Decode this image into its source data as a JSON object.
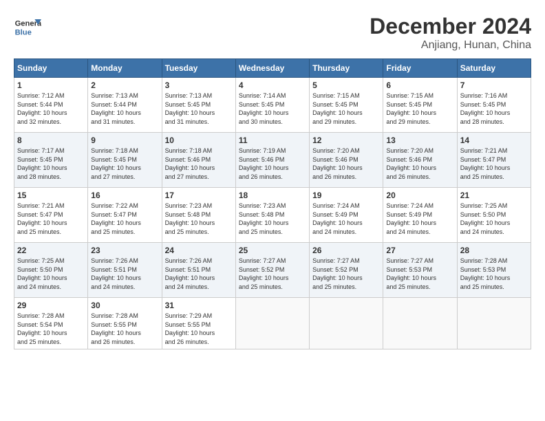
{
  "header": {
    "logo_line1": "General",
    "logo_line2": "Blue",
    "month": "December 2024",
    "location": "Anjiang, Hunan, China"
  },
  "weekdays": [
    "Sunday",
    "Monday",
    "Tuesday",
    "Wednesday",
    "Thursday",
    "Friday",
    "Saturday"
  ],
  "weeks": [
    [
      {
        "day": "1",
        "info": "Sunrise: 7:12 AM\nSunset: 5:44 PM\nDaylight: 10 hours\nand 32 minutes."
      },
      {
        "day": "2",
        "info": "Sunrise: 7:13 AM\nSunset: 5:44 PM\nDaylight: 10 hours\nand 31 minutes."
      },
      {
        "day": "3",
        "info": "Sunrise: 7:13 AM\nSunset: 5:45 PM\nDaylight: 10 hours\nand 31 minutes."
      },
      {
        "day": "4",
        "info": "Sunrise: 7:14 AM\nSunset: 5:45 PM\nDaylight: 10 hours\nand 30 minutes."
      },
      {
        "day": "5",
        "info": "Sunrise: 7:15 AM\nSunset: 5:45 PM\nDaylight: 10 hours\nand 29 minutes."
      },
      {
        "day": "6",
        "info": "Sunrise: 7:15 AM\nSunset: 5:45 PM\nDaylight: 10 hours\nand 29 minutes."
      },
      {
        "day": "7",
        "info": "Sunrise: 7:16 AM\nSunset: 5:45 PM\nDaylight: 10 hours\nand 28 minutes."
      }
    ],
    [
      {
        "day": "8",
        "info": "Sunrise: 7:17 AM\nSunset: 5:45 PM\nDaylight: 10 hours\nand 28 minutes."
      },
      {
        "day": "9",
        "info": "Sunrise: 7:18 AM\nSunset: 5:45 PM\nDaylight: 10 hours\nand 27 minutes."
      },
      {
        "day": "10",
        "info": "Sunrise: 7:18 AM\nSunset: 5:46 PM\nDaylight: 10 hours\nand 27 minutes."
      },
      {
        "day": "11",
        "info": "Sunrise: 7:19 AM\nSunset: 5:46 PM\nDaylight: 10 hours\nand 26 minutes."
      },
      {
        "day": "12",
        "info": "Sunrise: 7:20 AM\nSunset: 5:46 PM\nDaylight: 10 hours\nand 26 minutes."
      },
      {
        "day": "13",
        "info": "Sunrise: 7:20 AM\nSunset: 5:46 PM\nDaylight: 10 hours\nand 26 minutes."
      },
      {
        "day": "14",
        "info": "Sunrise: 7:21 AM\nSunset: 5:47 PM\nDaylight: 10 hours\nand 25 minutes."
      }
    ],
    [
      {
        "day": "15",
        "info": "Sunrise: 7:21 AM\nSunset: 5:47 PM\nDaylight: 10 hours\nand 25 minutes."
      },
      {
        "day": "16",
        "info": "Sunrise: 7:22 AM\nSunset: 5:47 PM\nDaylight: 10 hours\nand 25 minutes."
      },
      {
        "day": "17",
        "info": "Sunrise: 7:23 AM\nSunset: 5:48 PM\nDaylight: 10 hours\nand 25 minutes."
      },
      {
        "day": "18",
        "info": "Sunrise: 7:23 AM\nSunset: 5:48 PM\nDaylight: 10 hours\nand 25 minutes."
      },
      {
        "day": "19",
        "info": "Sunrise: 7:24 AM\nSunset: 5:49 PM\nDaylight: 10 hours\nand 24 minutes."
      },
      {
        "day": "20",
        "info": "Sunrise: 7:24 AM\nSunset: 5:49 PM\nDaylight: 10 hours\nand 24 minutes."
      },
      {
        "day": "21",
        "info": "Sunrise: 7:25 AM\nSunset: 5:50 PM\nDaylight: 10 hours\nand 24 minutes."
      }
    ],
    [
      {
        "day": "22",
        "info": "Sunrise: 7:25 AM\nSunset: 5:50 PM\nDaylight: 10 hours\nand 24 minutes."
      },
      {
        "day": "23",
        "info": "Sunrise: 7:26 AM\nSunset: 5:51 PM\nDaylight: 10 hours\nand 24 minutes."
      },
      {
        "day": "24",
        "info": "Sunrise: 7:26 AM\nSunset: 5:51 PM\nDaylight: 10 hours\nand 24 minutes."
      },
      {
        "day": "25",
        "info": "Sunrise: 7:27 AM\nSunset: 5:52 PM\nDaylight: 10 hours\nand 25 minutes."
      },
      {
        "day": "26",
        "info": "Sunrise: 7:27 AM\nSunset: 5:52 PM\nDaylight: 10 hours\nand 25 minutes."
      },
      {
        "day": "27",
        "info": "Sunrise: 7:27 AM\nSunset: 5:53 PM\nDaylight: 10 hours\nand 25 minutes."
      },
      {
        "day": "28",
        "info": "Sunrise: 7:28 AM\nSunset: 5:53 PM\nDaylight: 10 hours\nand 25 minutes."
      }
    ],
    [
      {
        "day": "29",
        "info": "Sunrise: 7:28 AM\nSunset: 5:54 PM\nDaylight: 10 hours\nand 25 minutes."
      },
      {
        "day": "30",
        "info": "Sunrise: 7:28 AM\nSunset: 5:55 PM\nDaylight: 10 hours\nand 26 minutes."
      },
      {
        "day": "31",
        "info": "Sunrise: 7:29 AM\nSunset: 5:55 PM\nDaylight: 10 hours\nand 26 minutes."
      },
      {
        "day": "",
        "info": ""
      },
      {
        "day": "",
        "info": ""
      },
      {
        "day": "",
        "info": ""
      },
      {
        "day": "",
        "info": ""
      }
    ]
  ]
}
